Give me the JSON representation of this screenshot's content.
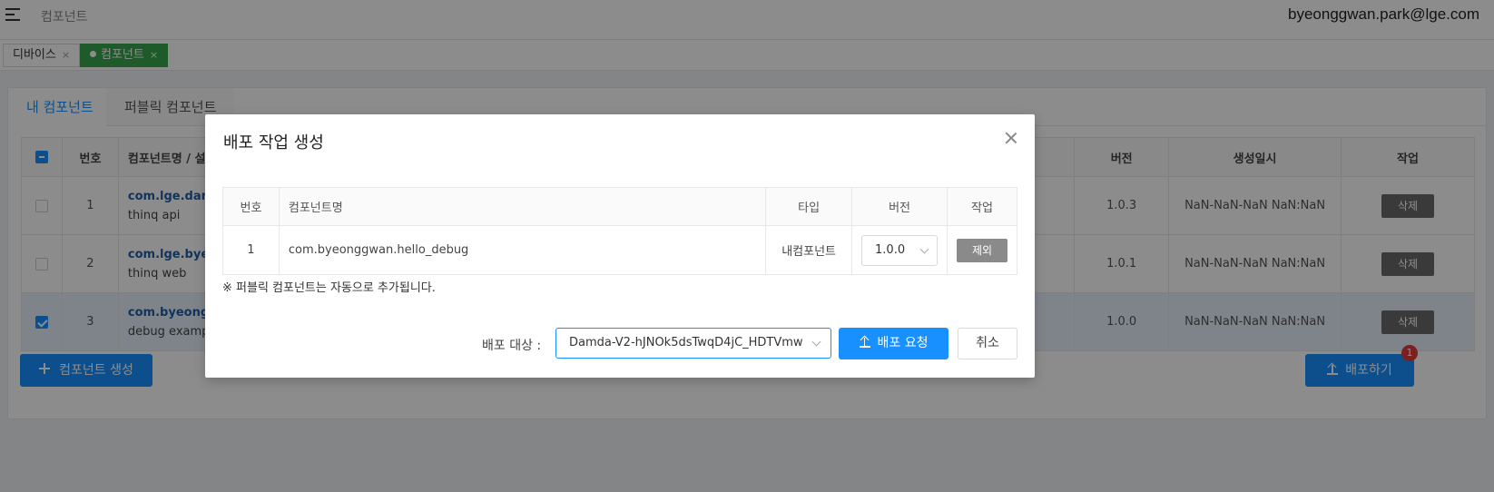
{
  "topbar": {
    "title": "컴포넌트",
    "user_email": "byeonggwan.park@lge.com"
  },
  "page_tabs": [
    {
      "label": "디바이스",
      "close": "×"
    },
    {
      "label": "컴포넌트",
      "close": "×"
    }
  ],
  "card_tabs": [
    {
      "label": "내 컴포넌트"
    },
    {
      "label": "퍼블릭 컴포넌트"
    }
  ],
  "main_table": {
    "headers": {
      "number": "번호",
      "name": "컴포넌트명 / 설",
      "version": "버전",
      "created": "생성일시",
      "action": "작업"
    },
    "rows": [
      {
        "number": "1",
        "pkg": "com.lge.damc",
        "desc": "thinq api",
        "version": "1.0.3",
        "created": "NaN-NaN-NaN NaN:NaN",
        "action": "삭제"
      },
      {
        "number": "2",
        "pkg": "com.lge.byeo",
        "desc": "thinq web",
        "version": "1.0.1",
        "created": "NaN-NaN-NaN NaN:NaN",
        "action": "삭제"
      },
      {
        "number": "3",
        "pkg": "com.byeongg",
        "desc": "debug example",
        "version": "1.0.0",
        "created": "NaN-NaN-NaN NaN:NaN",
        "action": "삭제"
      }
    ]
  },
  "buttons": {
    "create": "컴포넌트 생성",
    "deploy": "배포하기",
    "deploy_badge": "1"
  },
  "modal": {
    "title": "배포 작업 생성",
    "table": {
      "headers": {
        "number": "번호",
        "name": "컴포넌트명",
        "type": "타입",
        "version": "버전",
        "action": "작업"
      },
      "rows": [
        {
          "number": "1",
          "name": "com.byeonggwan.hello_debug",
          "type": "내컴포넌트",
          "version": "1.0.0",
          "action": "제외"
        }
      ]
    },
    "note": "※ 퍼블릭 컴포넌트는 자동으로 추가됩니다.",
    "target_label": "배포 대상 :",
    "target_value": "Damda-V2-hJNOk5dsTwqD4jC_HDTVmw",
    "submit": "배포 요청",
    "cancel": "취소"
  },
  "colors": {
    "primary": "#1890ff",
    "active_tab": "#3aa74d",
    "badge": "#e03a3a",
    "delete_button": "#6b6b6b"
  }
}
